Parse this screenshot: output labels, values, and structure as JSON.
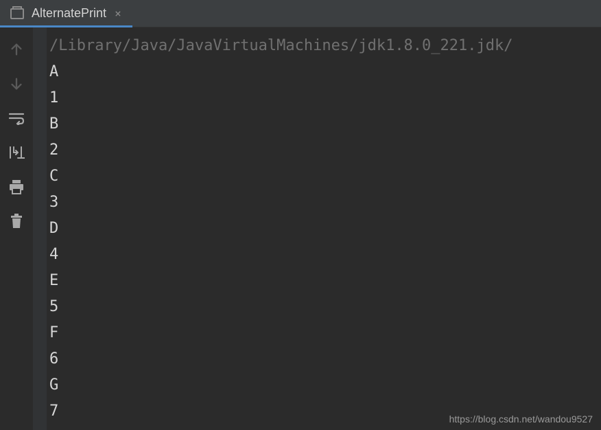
{
  "tab": {
    "title": "AlternatePrint",
    "close_glyph": "×"
  },
  "icons": {
    "run": "run-icon",
    "arrow_up": "arrow-up-icon",
    "arrow_down": "arrow-down-icon",
    "wrap": "soft-wrap-icon",
    "scroll_end": "scroll-to-end-icon",
    "print": "print-icon",
    "trash": "trash-icon"
  },
  "console": {
    "command": "/Library/Java/JavaVirtualMachines/jdk1.8.0_221.jdk/",
    "lines": [
      "A",
      "1",
      "B",
      "2",
      "C",
      "3",
      "D",
      "4",
      "E",
      "5",
      "F",
      "6",
      "G",
      "7"
    ]
  },
  "watermark": "https://blog.csdn.net/wandou9527"
}
